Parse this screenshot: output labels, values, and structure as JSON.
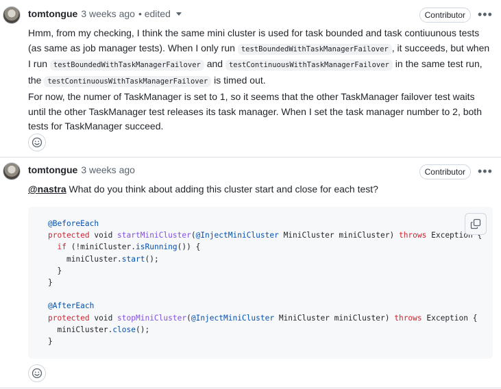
{
  "comments": [
    {
      "author": "tomtongue",
      "time": "3 weeks ago",
      "edited": "• edited",
      "badge": "Contributor",
      "more": "•••",
      "para1": {
        "t1": "Hmm, from my checking, I think the same mini cluster is used for task bounded and task contiuunous tests (as same as job manager tests). When I only run ",
        "c1": "testBoundedWithTaskManagerFailover",
        "t2": ", it succeeds, but when I run ",
        "c2": "testBoundedWithTaskManagerFailover",
        "t3": " and ",
        "c3": "testContinuousWithTaskManagerFailover",
        "t4": " in the same test run, the ",
        "c4": "testContinuousWithTaskManagerFailover",
        "t5": " is timed out."
      },
      "para2": "For now, the numer of TaskManager is set to 1, so it seems that the other TaskManager failover test waits until the other TaskManager test releases its task manager. When I set the task manager number to 2, both tests for TaskManager succeed."
    },
    {
      "author": "tomtongue",
      "time": "3 weeks ago",
      "badge": "Contributor",
      "more": "•••",
      "mention": "@nastra",
      "text": " What do you think about adding this cluster start and close for each test?",
      "code": {
        "l1_ann": "@BeforeEach",
        "l2_kw": "protected",
        "l2_void": " void ",
        "l2_fn": "startMiniCluster",
        "l2_p1": "(",
        "l2_ann": "@InjectMiniCluster",
        "l2_rest": " MiniCluster miniCluster) ",
        "l2_throws": "throws",
        "l2_end": " Exception {",
        "l3_if": "if",
        "l3_a": " (!miniCluster.",
        "l3_fn": "isRunning",
        "l3_b": "()) {",
        "l4_a": "miniCluster.",
        "l4_fn": "start",
        "l4_b": "();",
        "l5": "}",
        "l6": "}",
        "l8_ann": "@AfterEach",
        "l9_kw": "protected",
        "l9_void": " void ",
        "l9_fn": "stopMiniCluster",
        "l9_p1": "(",
        "l9_ann": "@InjectMiniCluster",
        "l9_rest": " MiniCluster miniCluster) ",
        "l9_throws": "throws",
        "l9_end": " Exception {",
        "l10_a": "miniCluster.",
        "l10_fn": "close",
        "l10_b": "();",
        "l11": "}"
      }
    }
  ],
  "icons": {
    "reaction": "smiley-icon",
    "copy": "copy-icon"
  },
  "colors": {
    "keyword": "#cf222e",
    "annotation": "#0550ae",
    "function": "#8250df",
    "code_bg": "#f6f8fa"
  }
}
